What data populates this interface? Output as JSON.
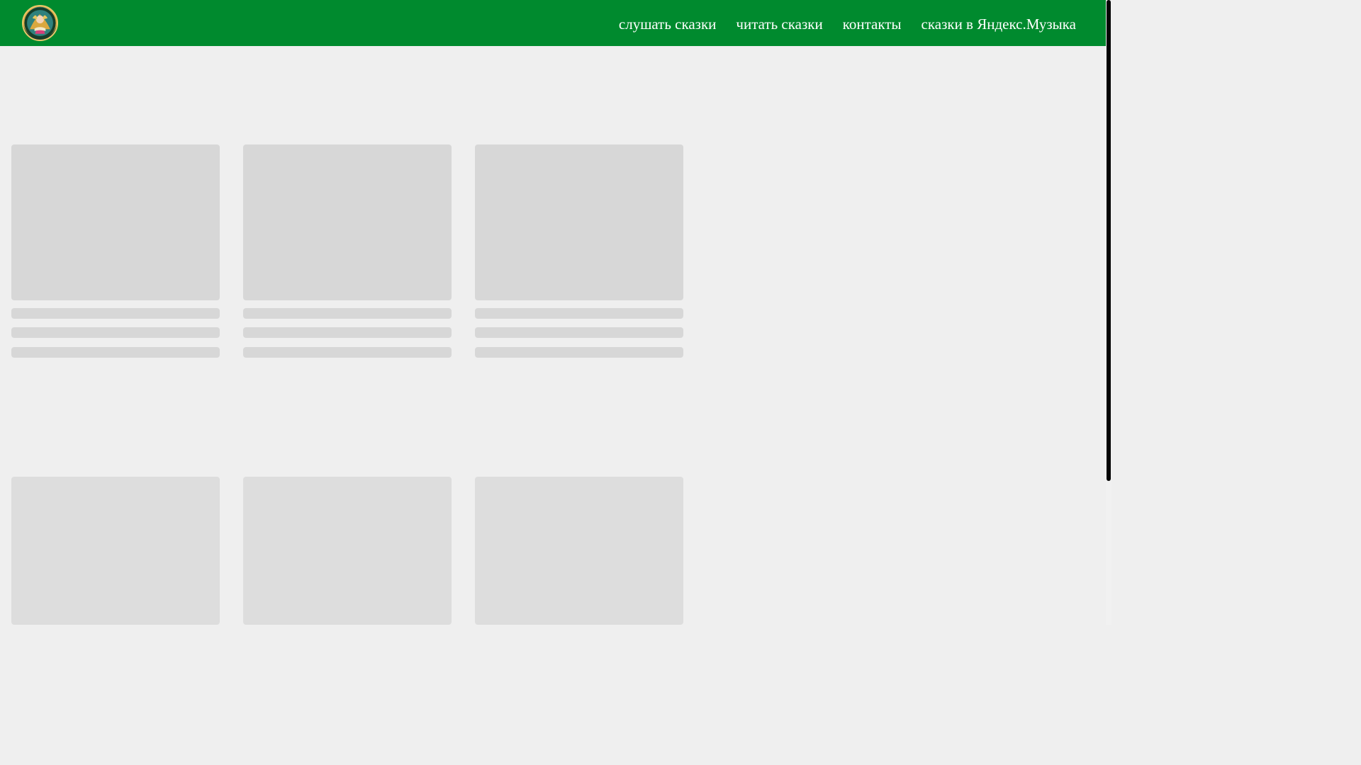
{
  "header": {
    "logo_icon": "storybook-logo-icon",
    "background_color": "#008a2e",
    "nav_items": [
      {
        "label": "слушать сказки"
      },
      {
        "label": "читать сказки"
      },
      {
        "label": "контакты"
      },
      {
        "label": "сказки в Яндекс.Музыка"
      }
    ]
  },
  "content": {
    "state": "loading placeholders",
    "placeholder_color": "#d7d7d7",
    "rows": [
      {
        "cards": [
          {
            "placeholder_lines": 3
          },
          {
            "placeholder_lines": 3
          },
          {
            "placeholder_lines": 3
          }
        ]
      },
      {
        "cards": [
          {
            "placeholder_lines": 0
          },
          {
            "placeholder_lines": 0
          },
          {
            "placeholder_lines": 0
          }
        ]
      }
    ]
  },
  "scrollbar": {
    "visible": true,
    "thumb_color": "#050505"
  }
}
